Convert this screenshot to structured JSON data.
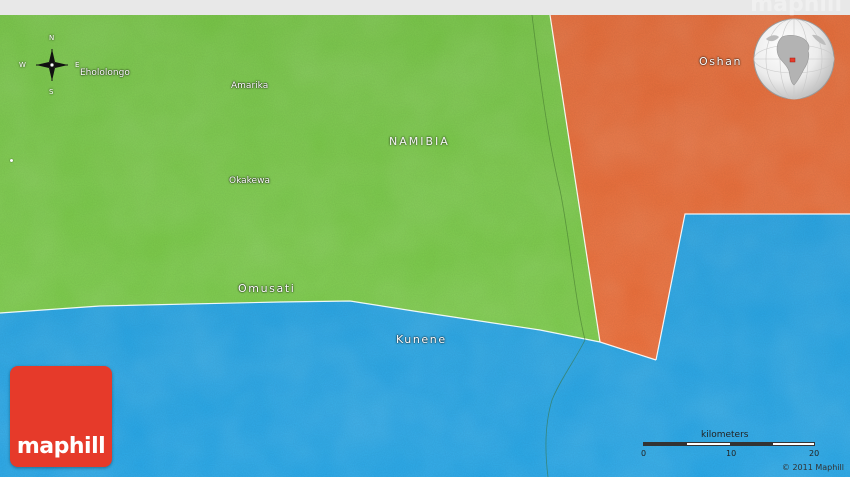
{
  "map": {
    "country_label": "NAMIBIA",
    "regions": [
      {
        "name": "Omusati",
        "color": "#7dcf4a"
      },
      {
        "name": "Kunene",
        "color": "#26a7e8"
      },
      {
        "name": "Oshan",
        "color": "#f0703a"
      }
    ],
    "towns": [
      "Ehololongo",
      "Amarika",
      "Okakewa"
    ],
    "compass": {
      "north": "N",
      "south": "S",
      "east": "E",
      "west": "W"
    },
    "scale": {
      "title": "kilometers",
      "ticks": [
        "0",
        "10",
        "20"
      ]
    },
    "copyright": "© 2011 Maphill",
    "logo_text": "maphill",
    "watermark": "maphill",
    "colors": {
      "land_green": "#7dcf4a",
      "water_blue": "#26a7e8",
      "region_orange": "#f0703a",
      "logo_red": "#e63a2a"
    }
  }
}
